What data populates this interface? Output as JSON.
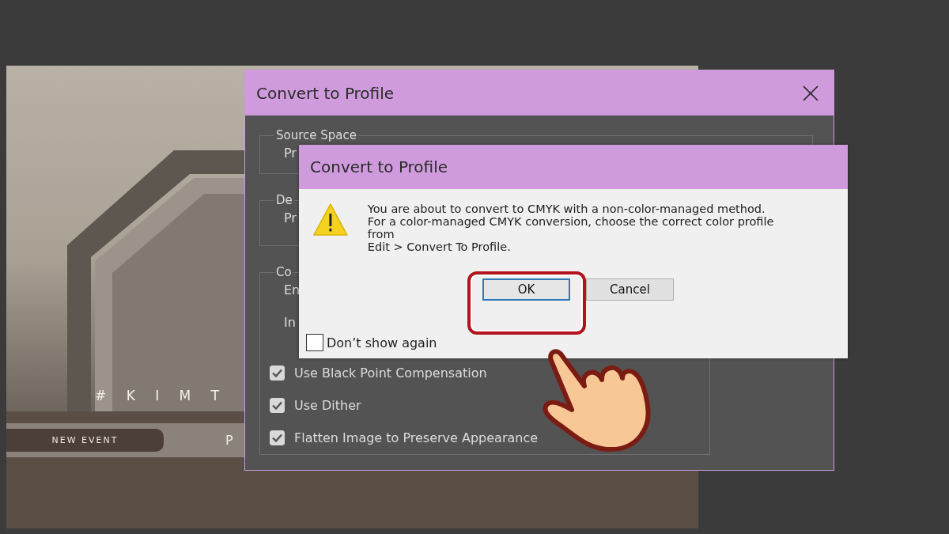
{
  "canvas": {
    "hashtag": "# K I M T",
    "event_button": "NEW EVENT",
    "letter": "P"
  },
  "background_dialog": {
    "title": "Convert to Profile",
    "groups": [
      {
        "label": "Source Space",
        "fields": [
          "Pr"
        ]
      },
      {
        "label": "De",
        "fields": [
          "Pr"
        ]
      },
      {
        "label": "Co",
        "fields": [
          "En",
          "In"
        ],
        "options": [
          {
            "label": "Use Black Point Compensation",
            "checked": true
          },
          {
            "label": "Use Dither",
            "checked": true
          },
          {
            "label": "Flatten Image to Preserve Appearance",
            "checked": true
          }
        ]
      }
    ]
  },
  "alert_dialog": {
    "title": "Convert to Profile",
    "message": "You are about to convert to CMYK with a non-color-managed method.\nFor a color-managed CMYK conversion, choose the correct color profile\nfrom\nEdit > Convert To Profile.",
    "buttons": [
      {
        "label": "OK",
        "selected": true
      },
      {
        "label": "Cancel",
        "selected": false
      }
    ],
    "dont_show_again": {
      "label": "Don’t show again",
      "checked": false
    }
  }
}
